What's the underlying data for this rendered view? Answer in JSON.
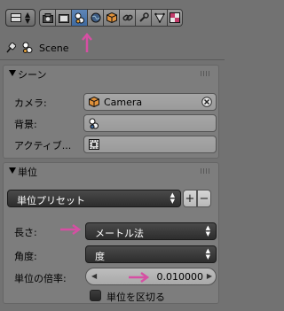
{
  "toolbar": {
    "context_tabs": [
      "render-icon",
      "render-layers-icon",
      "scene-icon",
      "world-icon",
      "object-icon",
      "constraints-icon",
      "modifiers-icon",
      "data-icon",
      "material-icon"
    ],
    "active_tab": "scene-icon"
  },
  "breadcrumb": {
    "label": "Scene"
  },
  "scene_panel": {
    "title": "シーン",
    "camera_label": "カメラ:",
    "camera_value": "Camera",
    "background_label": "背景:",
    "active_label": "アクティブ..."
  },
  "units_panel": {
    "title": "単位",
    "preset_label": "単位プリセット",
    "length_label": "長さ:",
    "length_value": "メートル法",
    "angle_label": "角度:",
    "angle_value": "度",
    "scale_label": "単位の倍率:",
    "scale_value": "0.010000",
    "separate_label": "単位を区切る"
  },
  "colors": {
    "background": "#727272",
    "panel": "#7d7d7d",
    "active_tab": "#4f78ad",
    "arrow": "#d64fa3"
  }
}
